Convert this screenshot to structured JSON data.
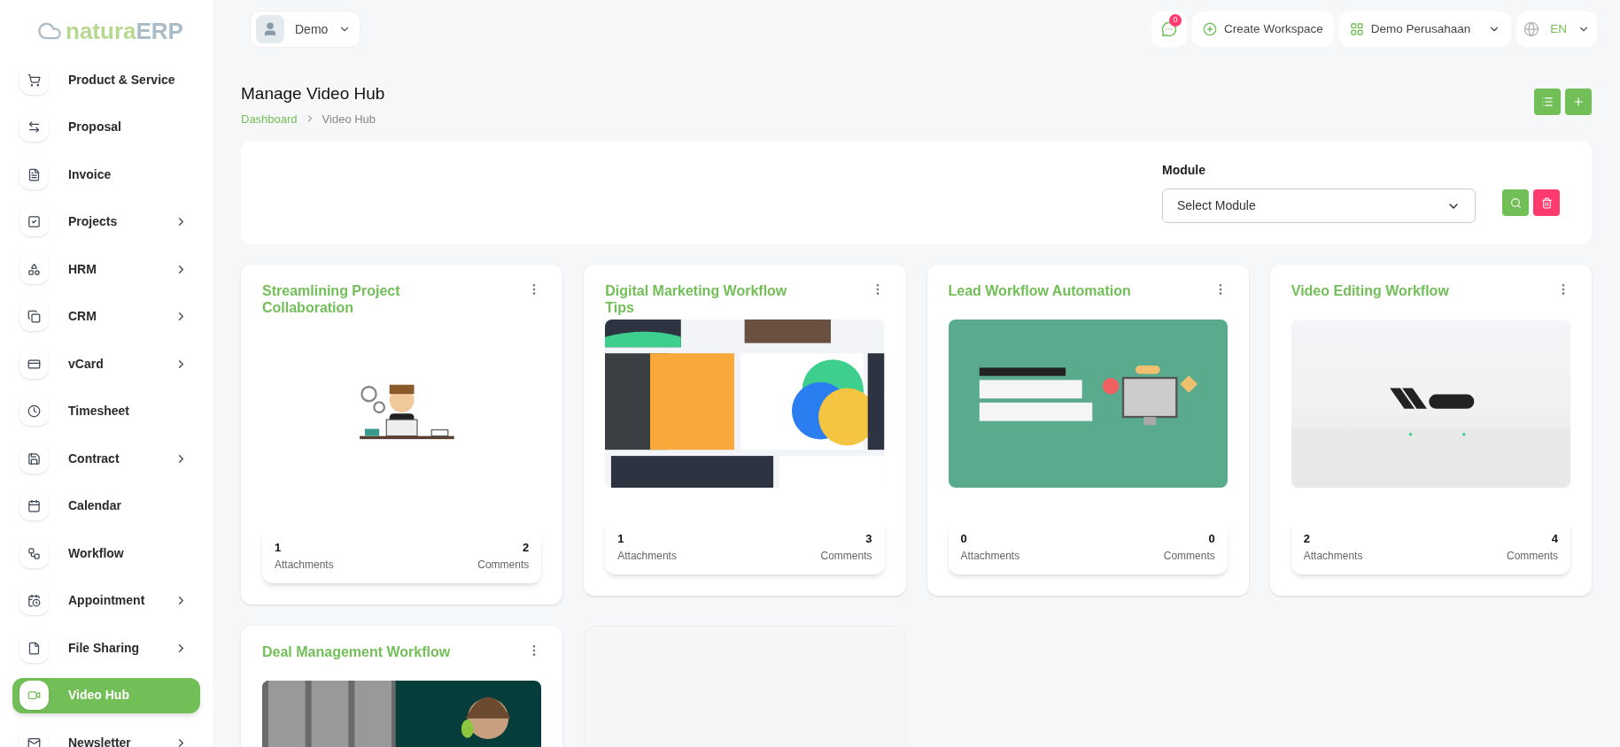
{
  "logo": {
    "primary": "natura",
    "secondary": "ERP"
  },
  "user": {
    "name": "Demo"
  },
  "header": {
    "chat_badge": "0",
    "create_workspace": "Create Workspace",
    "workspace": "Demo Perusahaan",
    "language": "EN"
  },
  "sidebar": {
    "items": [
      {
        "label": "Product & Service",
        "submenu": false,
        "selected": false
      },
      {
        "label": "Proposal",
        "submenu": false,
        "selected": false
      },
      {
        "label": "Invoice",
        "submenu": false,
        "selected": false
      },
      {
        "label": "Projects",
        "submenu": true,
        "selected": false
      },
      {
        "label": "HRM",
        "submenu": true,
        "selected": false
      },
      {
        "label": "CRM",
        "submenu": true,
        "selected": false
      },
      {
        "label": "vCard",
        "submenu": true,
        "selected": false
      },
      {
        "label": "Timesheet",
        "submenu": false,
        "selected": false
      },
      {
        "label": "Contract",
        "submenu": true,
        "selected": false
      },
      {
        "label": "Calendar",
        "submenu": false,
        "selected": false
      },
      {
        "label": "Workflow",
        "submenu": false,
        "selected": false
      },
      {
        "label": "Appointment",
        "submenu": true,
        "selected": false
      },
      {
        "label": "File Sharing",
        "submenu": true,
        "selected": false
      },
      {
        "label": "Video Hub",
        "submenu": false,
        "selected": true
      },
      {
        "label": "Newsletter",
        "submenu": true,
        "selected": false
      }
    ]
  },
  "page": {
    "title": "Manage Video Hub",
    "breadcrumb": [
      "Dashboard",
      "Video Hub"
    ]
  },
  "filter": {
    "label": "Module",
    "placeholder": "Select Module"
  },
  "cards": [
    {
      "title": "Streamlining Project Collaboration",
      "attachments": "1",
      "attachments_label": "Attachments",
      "comments": "2",
      "comments_label": "Comments"
    },
    {
      "title": "Digital Marketing Workflow Tips",
      "attachments": "1",
      "attachments_label": "Attachments",
      "comments": "3",
      "comments_label": "Comments"
    },
    {
      "title": "Lead Workflow Automation",
      "attachments": "0",
      "attachments_label": "Attachments",
      "comments": "0",
      "comments_label": "Comments"
    },
    {
      "title": "Video Editing Workflow",
      "attachments": "2",
      "attachments_label": "Attachments",
      "comments": "4",
      "comments_label": "Comments"
    },
    {
      "title": "Deal Management Workflow"
    }
  ]
}
